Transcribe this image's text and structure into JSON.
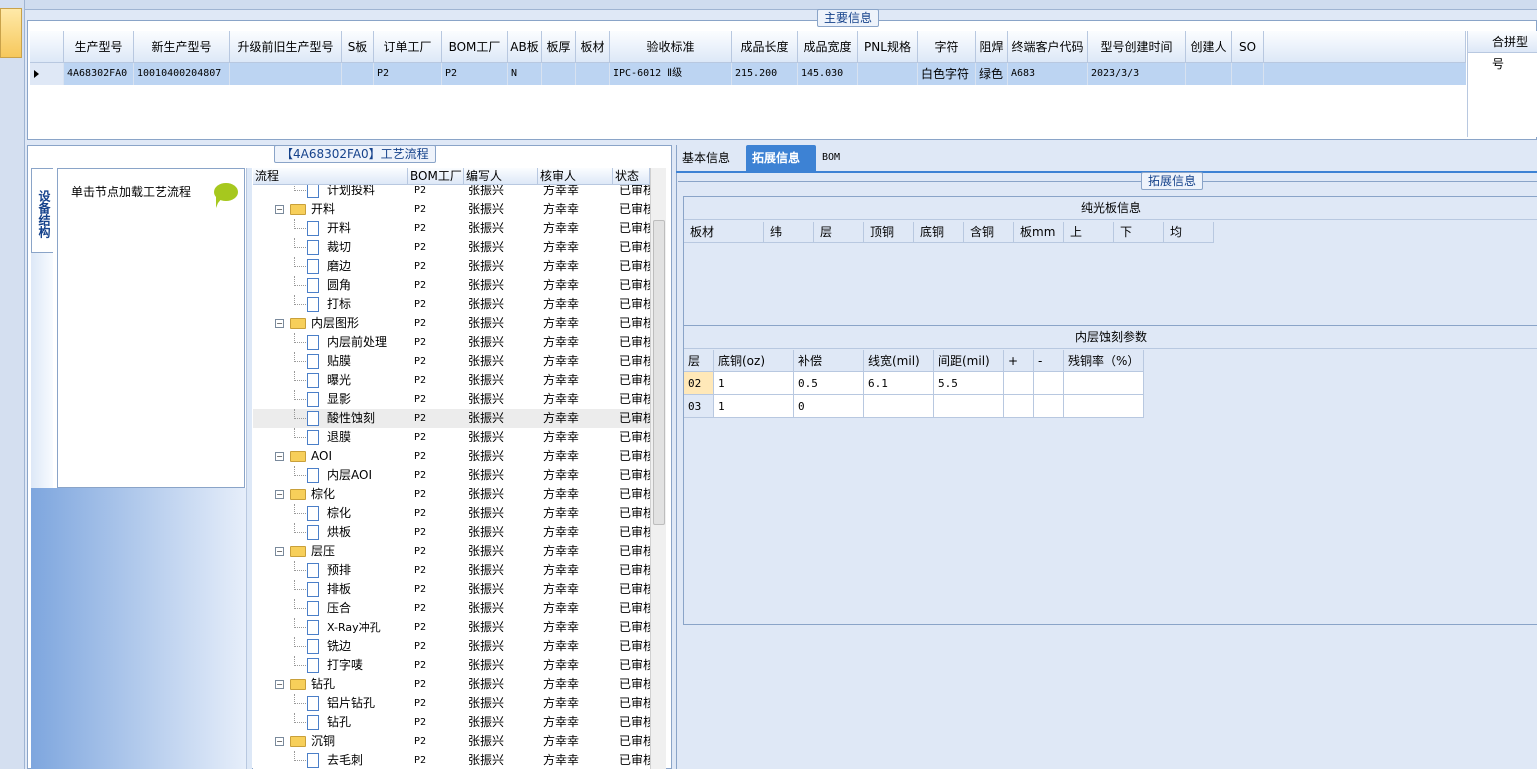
{
  "main_info": {
    "title": "主要信息",
    "columns": [
      "生产型号",
      "新生产型号",
      "升级前旧生产型号",
      "S板",
      "订单工厂",
      "BOM工厂",
      "AB板",
      "板厚",
      "板材",
      "验收标准",
      "成品长度",
      "成品宽度",
      "PNL规格",
      "字符",
      "阻焊",
      "终端客户代码",
      "型号创建时间",
      "创建人",
      "SO"
    ],
    "row": {
      "生产型号": "4A68302FA0",
      "新生产型号": "10010400204807",
      "升级前旧生产型号": "",
      "S板": "",
      "订单工厂": "P2",
      "BOM工厂": "P2",
      "AB板": "N",
      "板厚": "",
      "板材": "",
      "验收标准": "IPC-6012 Ⅱ级",
      "成品长度": "215.200",
      "成品宽度": "145.030",
      "PNL规格": "",
      "字符": "白色字符",
      "阻焊": "绿色",
      "终端客户代码": "A683",
      "型号创建时间": "2023/3/3",
      "创建人": "",
      "SO": ""
    },
    "combined_header": "合拼型号"
  },
  "process_flow": {
    "title": "【4A68302FA0】工艺流程",
    "side_tab": "设备结构",
    "hint": "单击节点加载工艺流程",
    "columns": [
      "流程",
      "BOM工厂",
      "编写人",
      "核审人",
      "状态"
    ],
    "rows": [
      {
        "name": "计划投料",
        "kind": "leaf",
        "bom": "P2",
        "writer": "张振兴",
        "reviewer": "方幸幸",
        "status": "已审核"
      },
      {
        "name": "开料",
        "kind": "folder",
        "bom": "P2",
        "writer": "张振兴",
        "reviewer": "方幸幸",
        "status": "已审核"
      },
      {
        "name": "开料",
        "kind": "leaf",
        "bom": "P2",
        "writer": "张振兴",
        "reviewer": "方幸幸",
        "status": "已审核"
      },
      {
        "name": "裁切",
        "kind": "leaf",
        "bom": "P2",
        "writer": "张振兴",
        "reviewer": "方幸幸",
        "status": "已审核"
      },
      {
        "name": "磨边",
        "kind": "leaf",
        "bom": "P2",
        "writer": "张振兴",
        "reviewer": "方幸幸",
        "status": "已审核"
      },
      {
        "name": "圆角",
        "kind": "leaf",
        "bom": "P2",
        "writer": "张振兴",
        "reviewer": "方幸幸",
        "status": "已审核"
      },
      {
        "name": "打标",
        "kind": "leaf",
        "bom": "P2",
        "writer": "张振兴",
        "reviewer": "方幸幸",
        "status": "已审核"
      },
      {
        "name": "内层图形",
        "kind": "folder",
        "bom": "P2",
        "writer": "张振兴",
        "reviewer": "方幸幸",
        "status": "已审核"
      },
      {
        "name": "内层前处理",
        "kind": "leaf",
        "bom": "P2",
        "writer": "张振兴",
        "reviewer": "方幸幸",
        "status": "已审核"
      },
      {
        "name": "贴膜",
        "kind": "leaf",
        "bom": "P2",
        "writer": "张振兴",
        "reviewer": "方幸幸",
        "status": "已审核"
      },
      {
        "name": "曝光",
        "kind": "leaf",
        "bom": "P2",
        "writer": "张振兴",
        "reviewer": "方幸幸",
        "status": "已审核"
      },
      {
        "name": "显影",
        "kind": "leaf",
        "bom": "P2",
        "writer": "张振兴",
        "reviewer": "方幸幸",
        "status": "已审核"
      },
      {
        "name": "酸性蚀刻",
        "kind": "leaf",
        "bom": "P2",
        "writer": "张振兴",
        "reviewer": "方幸幸",
        "status": "已审核",
        "selected": true
      },
      {
        "name": "退膜",
        "kind": "leaf",
        "bom": "P2",
        "writer": "张振兴",
        "reviewer": "方幸幸",
        "status": "已审核"
      },
      {
        "name": "AOI",
        "kind": "folder",
        "bom": "P2",
        "writer": "张振兴",
        "reviewer": "方幸幸",
        "status": "已审核"
      },
      {
        "name": "内层AOI",
        "kind": "leaf",
        "bom": "P2",
        "writer": "张振兴",
        "reviewer": "方幸幸",
        "status": "已审核"
      },
      {
        "name": "棕化",
        "kind": "folder",
        "bom": "P2",
        "writer": "张振兴",
        "reviewer": "方幸幸",
        "status": "已审核"
      },
      {
        "name": "棕化",
        "kind": "leaf",
        "bom": "P2",
        "writer": "张振兴",
        "reviewer": "方幸幸",
        "status": "已审核"
      },
      {
        "name": "烘板",
        "kind": "leaf",
        "bom": "P2",
        "writer": "张振兴",
        "reviewer": "方幸幸",
        "status": "已审核"
      },
      {
        "name": "层压",
        "kind": "folder",
        "bom": "P2",
        "writer": "张振兴",
        "reviewer": "方幸幸",
        "status": "已审核"
      },
      {
        "name": "预排",
        "kind": "leaf",
        "bom": "P2",
        "writer": "张振兴",
        "reviewer": "方幸幸",
        "status": "已审核"
      },
      {
        "name": "排板",
        "kind": "leaf",
        "bom": "P2",
        "writer": "张振兴",
        "reviewer": "方幸幸",
        "status": "已审核"
      },
      {
        "name": "压合",
        "kind": "leaf",
        "bom": "P2",
        "writer": "张振兴",
        "reviewer": "方幸幸",
        "status": "已审核"
      },
      {
        "name": "X-Ray冲孔",
        "kind": "leaf",
        "bom": "P2",
        "writer": "张振兴",
        "reviewer": "方幸幸",
        "status": "已审核"
      },
      {
        "name": "铣边",
        "kind": "leaf",
        "bom": "P2",
        "writer": "张振兴",
        "reviewer": "方幸幸",
        "status": "已审核"
      },
      {
        "name": "打字唛",
        "kind": "leaf",
        "bom": "P2",
        "writer": "张振兴",
        "reviewer": "方幸幸",
        "status": "已审核"
      },
      {
        "name": "钻孔",
        "kind": "folder",
        "bom": "P2",
        "writer": "张振兴",
        "reviewer": "方幸幸",
        "status": "已审核"
      },
      {
        "name": "铝片钻孔",
        "kind": "leaf",
        "bom": "P2",
        "writer": "张振兴",
        "reviewer": "方幸幸",
        "status": "已审核"
      },
      {
        "name": "钻孔",
        "kind": "leaf",
        "bom": "P2",
        "writer": "张振兴",
        "reviewer": "方幸幸",
        "status": "已审核"
      },
      {
        "name": "沉铜",
        "kind": "folder",
        "bom": "P2",
        "writer": "张振兴",
        "reviewer": "方幸幸",
        "status": "已审核"
      },
      {
        "name": "去毛刺",
        "kind": "leaf",
        "bom": "P2",
        "writer": "张振兴",
        "reviewer": "方幸幸",
        "status": "已审核"
      }
    ]
  },
  "detail_tabs": {
    "items": [
      "基本信息",
      "拓展信息",
      "BOM"
    ],
    "active_index": 1
  },
  "extended_info": {
    "title": "拓展信息",
    "bare_board": {
      "title": "纯光板信息",
      "columns": [
        "板材",
        "纬",
        "层",
        "顶铜",
        "底铜",
        "含铜",
        "板mm",
        "上",
        "下",
        "均"
      ]
    },
    "inner_etch": {
      "title": "内层蚀刻参数",
      "columns": [
        "层",
        "底铜(oz)",
        "补偿",
        "线宽(mil)",
        "间距(mil)",
        "+",
        "-",
        "残铜率（%）"
      ],
      "rows": [
        [
          "02",
          "1",
          "0.5",
          "6.1",
          "5.5",
          "",
          "",
          ""
        ],
        [
          "03",
          "1",
          "0",
          "",
          "",
          "",
          "",
          ""
        ]
      ]
    }
  },
  "colors": {
    "panel_bg": "#dfe8f6",
    "border": "#8aa4c8",
    "selected_row": "#bcd4f2",
    "active_tab": "#3d82d4",
    "title_text": "#15428b"
  }
}
